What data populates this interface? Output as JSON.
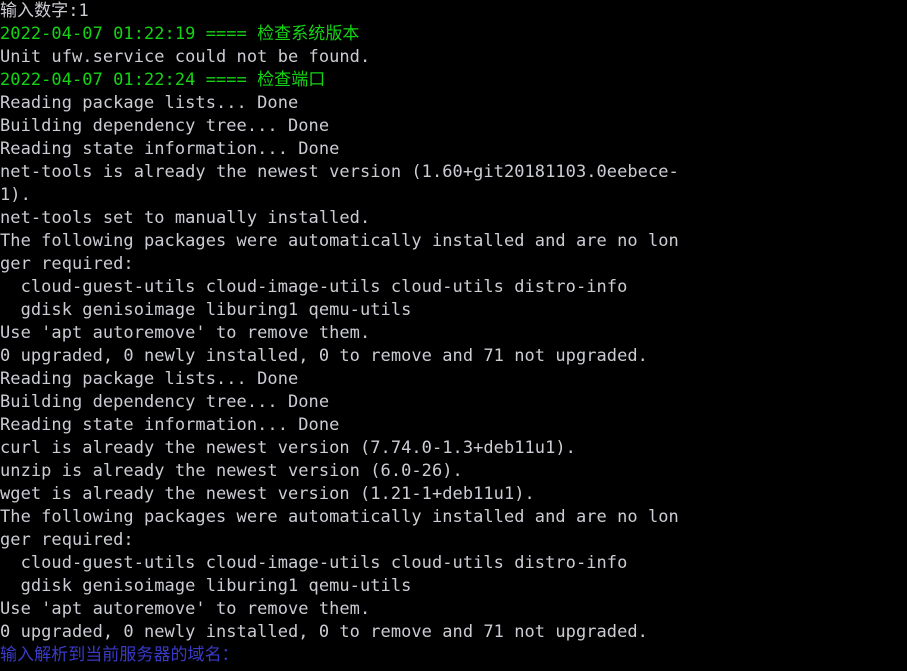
{
  "terminal": {
    "title": "Terminal",
    "columns": 70,
    "rows": 29,
    "colors": {
      "background": "#000000",
      "default_text": "#cccdd4",
      "green": "#14d414",
      "blue": "#3a3ac8"
    },
    "lines": [
      {
        "id": "line-prompt-input-number",
        "segments": [
          {
            "text": "输入数字:1",
            "color": "default"
          }
        ]
      },
      {
        "id": "line-check-system-version",
        "segments": [
          {
            "text": "2022-04-07 01:22:19 ==== 检查系统版本",
            "color": "green"
          }
        ]
      },
      {
        "id": "line-ufw-not-found",
        "segments": [
          {
            "text": "Unit ufw.service could not be found.",
            "color": "default"
          }
        ]
      },
      {
        "id": "line-check-port",
        "segments": [
          {
            "text": "2022-04-07 01:22:24 ==== 检查端口",
            "color": "green"
          }
        ]
      },
      {
        "id": "line-reading-package-lists-1",
        "segments": [
          {
            "text": "Reading package lists... Done",
            "color": "default"
          }
        ]
      },
      {
        "id": "line-building-dep-tree-1",
        "segments": [
          {
            "text": "Building dependency tree... Done",
            "color": "default"
          }
        ]
      },
      {
        "id": "line-reading-state-info-1",
        "segments": [
          {
            "text": "Reading state information... Done",
            "color": "default"
          }
        ]
      },
      {
        "id": "line-net-tools-newest",
        "segments": [
          {
            "text": "net-tools is already the newest version (1.60+git20181103.0eebece-",
            "color": "default"
          }
        ]
      },
      {
        "id": "line-net-tools-newest-wrap",
        "segments": [
          {
            "text": "1).",
            "color": "default"
          }
        ]
      },
      {
        "id": "line-net-tools-manual",
        "segments": [
          {
            "text": "net-tools set to manually installed.",
            "color": "default"
          }
        ]
      },
      {
        "id": "line-auto-installed-1",
        "segments": [
          {
            "text": "The following packages were automatically installed and are no lon",
            "color": "default"
          }
        ]
      },
      {
        "id": "line-auto-installed-1-wrap",
        "segments": [
          {
            "text": "ger required:",
            "color": "default"
          }
        ]
      },
      {
        "id": "line-pkgs-1a",
        "segments": [
          {
            "text": "  cloud-guest-utils cloud-image-utils cloud-utils distro-info",
            "color": "default"
          }
        ]
      },
      {
        "id": "line-pkgs-1b",
        "segments": [
          {
            "text": "  gdisk genisoimage liburing1 qemu-utils",
            "color": "default"
          }
        ]
      },
      {
        "id": "line-autoremove-hint-1",
        "segments": [
          {
            "text": "Use 'apt autoremove' to remove them.",
            "color": "default"
          }
        ]
      },
      {
        "id": "line-upgrade-summary-1",
        "segments": [
          {
            "text": "0 upgraded, 0 newly installed, 0 to remove and 71 not upgraded.",
            "color": "default"
          }
        ]
      },
      {
        "id": "line-reading-package-lists-2",
        "segments": [
          {
            "text": "Reading package lists... Done",
            "color": "default"
          }
        ]
      },
      {
        "id": "line-building-dep-tree-2",
        "segments": [
          {
            "text": "Building dependency tree... Done",
            "color": "default"
          }
        ]
      },
      {
        "id": "line-reading-state-info-2",
        "segments": [
          {
            "text": "Reading state information... Done",
            "color": "default"
          }
        ]
      },
      {
        "id": "line-curl-newest",
        "segments": [
          {
            "text": "curl is already the newest version (7.74.0-1.3+deb11u1).",
            "color": "default"
          }
        ]
      },
      {
        "id": "line-unzip-newest",
        "segments": [
          {
            "text": "unzip is already the newest version (6.0-26).",
            "color": "default"
          }
        ]
      },
      {
        "id": "line-wget-newest",
        "segments": [
          {
            "text": "wget is already the newest version (1.21-1+deb11u1).",
            "color": "default"
          }
        ]
      },
      {
        "id": "line-auto-installed-2",
        "segments": [
          {
            "text": "The following packages were automatically installed and are no lon",
            "color": "default"
          }
        ]
      },
      {
        "id": "line-auto-installed-2-wrap",
        "segments": [
          {
            "text": "ger required:",
            "color": "default"
          }
        ]
      },
      {
        "id": "line-pkgs-2a",
        "segments": [
          {
            "text": "  cloud-guest-utils cloud-image-utils cloud-utils distro-info",
            "color": "default"
          }
        ]
      },
      {
        "id": "line-pkgs-2b",
        "segments": [
          {
            "text": "  gdisk genisoimage liburing1 qemu-utils",
            "color": "default"
          }
        ]
      },
      {
        "id": "line-autoremove-hint-2",
        "segments": [
          {
            "text": "Use 'apt autoremove' to remove them.",
            "color": "default"
          }
        ]
      },
      {
        "id": "line-upgrade-summary-2",
        "segments": [
          {
            "text": "0 upgraded, 0 newly installed, 0 to remove and 71 not upgraded.",
            "color": "default"
          }
        ]
      },
      {
        "id": "line-prompt-domain",
        "segments": [
          {
            "text": "输入解析到当前服务器的域名：",
            "color": "blue"
          }
        ]
      }
    ]
  }
}
